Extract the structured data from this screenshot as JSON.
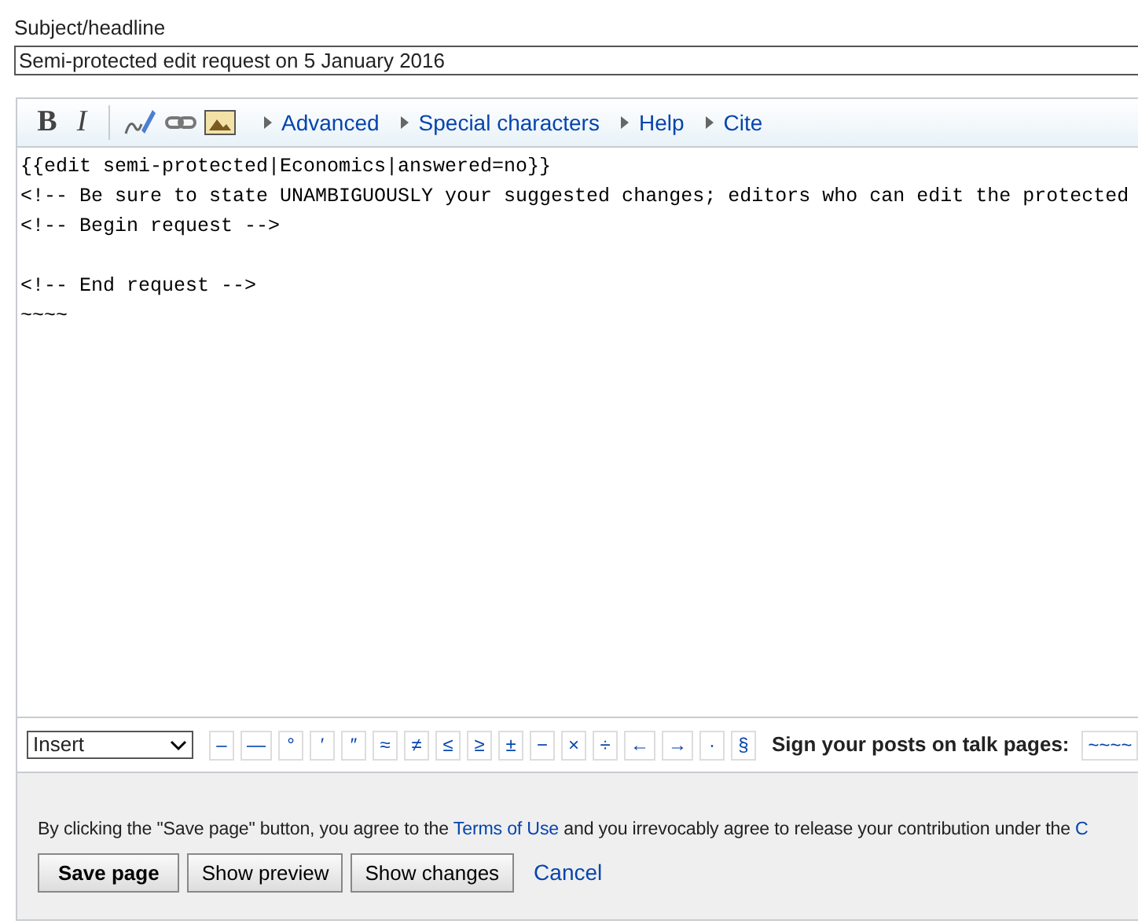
{
  "subject": {
    "label": "Subject/headline",
    "value": "Semi-protected edit request on 5 January 2016"
  },
  "toolbar": {
    "format_buttons": [
      {
        "kind": "bold",
        "label": "B"
      },
      {
        "kind": "italic",
        "label": "I"
      }
    ],
    "menus": [
      "Advanced",
      "Special characters",
      "Help",
      "Cite"
    ]
  },
  "editor": {
    "value": "{{edit semi-protected|Economics|answered=no}}\n<!-- Be sure to state UNAMBIGUOUSLY your suggested changes; editors who can edit the protected\n<!-- Begin request -->\n\n<!-- End request -->\n~~~~"
  },
  "special_characters": {
    "select": "Insert",
    "chars": [
      "–",
      "—",
      "°",
      "′",
      "″",
      "≈",
      "≠",
      "≤",
      "≥",
      "±",
      "−",
      "×",
      "÷",
      "←",
      "→",
      "·",
      "§"
    ],
    "sign_label": "Sign your posts on talk pages:",
    "sign_value": "~~~~"
  },
  "footer": {
    "notice": {
      "before": "By clicking the \"Save page\" button, you agree to the ",
      "link": "Terms of Use",
      "after": " and you irrevocably agree to release your contribution under the ",
      "link2": "C"
    },
    "buttons": [
      {
        "kind": "primary",
        "label": "Save page"
      },
      {
        "kind": "secondary",
        "label": "Show preview"
      },
      {
        "kind": "secondary",
        "label": "Show changes"
      },
      {
        "kind": "link",
        "label": "Cancel"
      }
    ]
  }
}
